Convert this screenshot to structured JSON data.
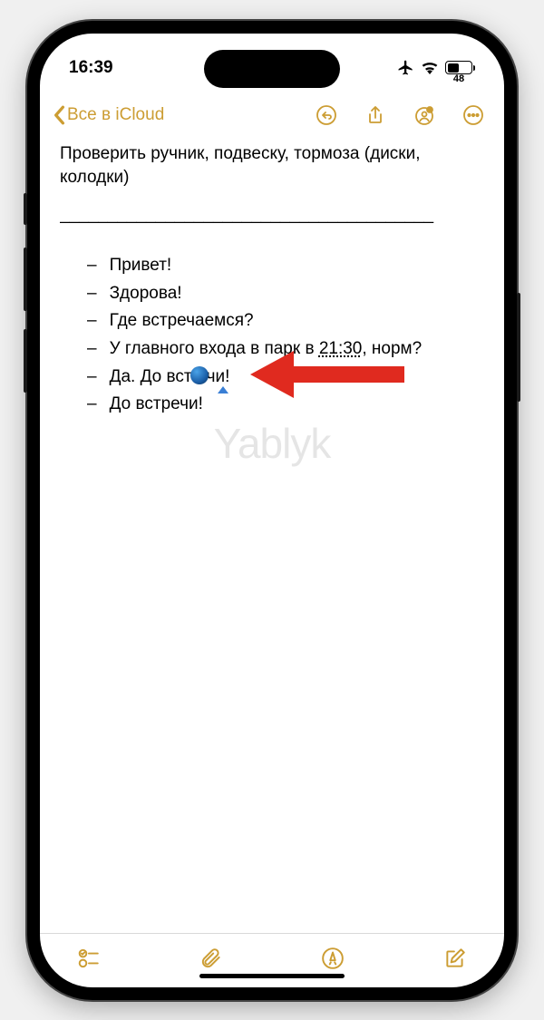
{
  "status": {
    "time": "16:39",
    "battery_percent": "48"
  },
  "nav": {
    "back_label": "Все в iCloud"
  },
  "note": {
    "heading": "Проверить ручник, подвеску, тормоза (диски, колодки)",
    "divider": "_______________________________________",
    "items": [
      "Привет!",
      "Здорова!",
      "Где встречаемся?",
      {
        "prefix": "У главного входа в парк в ",
        "time": "21:30",
        "suffix": ", норм?"
      },
      {
        "prefix": "Да. До вст",
        "suffix": "чи!"
      },
      "До встречи!"
    ]
  },
  "watermark": "Yablyk",
  "dash": "–"
}
